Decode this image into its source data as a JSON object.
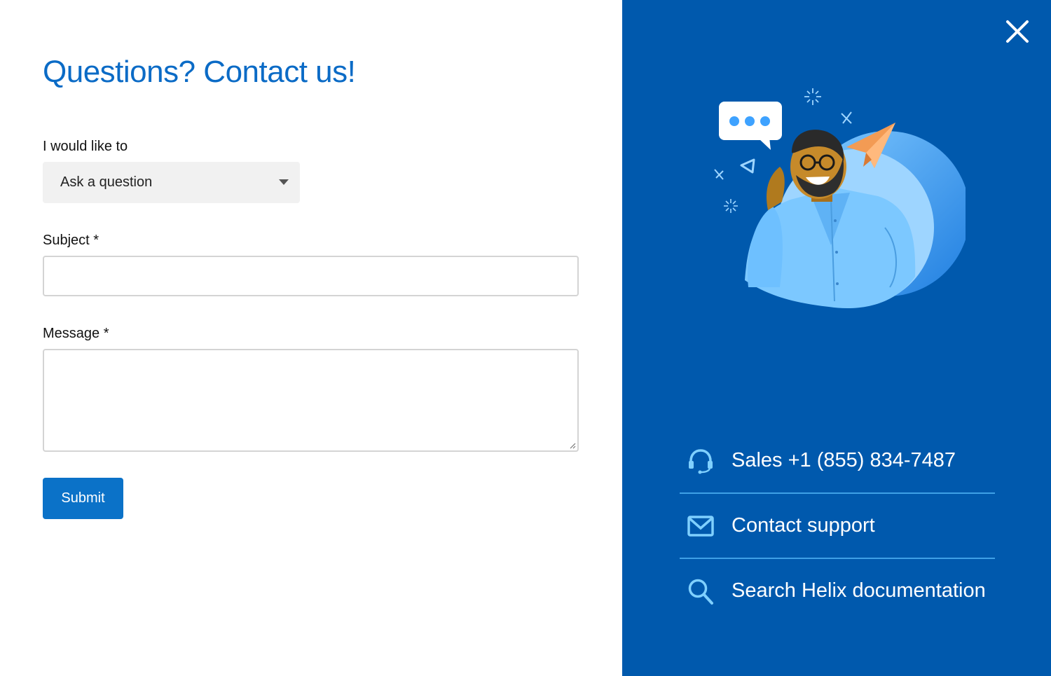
{
  "form": {
    "title": "Questions? Contact us!",
    "intent_label": "I would like to",
    "intent_value": "Ask a question",
    "subject_label": "Subject *",
    "subject_value": "",
    "message_label": "Message *",
    "message_value": "",
    "submit_label": "Submit"
  },
  "panel": {
    "close_icon": "close-icon",
    "links": [
      {
        "icon": "headset-icon",
        "label": "Sales +1 (855) 834-7487"
      },
      {
        "icon": "mail-icon",
        "label": "Contact support"
      },
      {
        "icon": "search-icon",
        "label": "Search Helix documentation"
      }
    ]
  },
  "colors": {
    "accent": "#0b6bc6",
    "button": "#0b72c8",
    "panel_bg": "#0059ad",
    "panel_divider": "#3fa0e6",
    "icon_light": "#7fd0ff"
  }
}
